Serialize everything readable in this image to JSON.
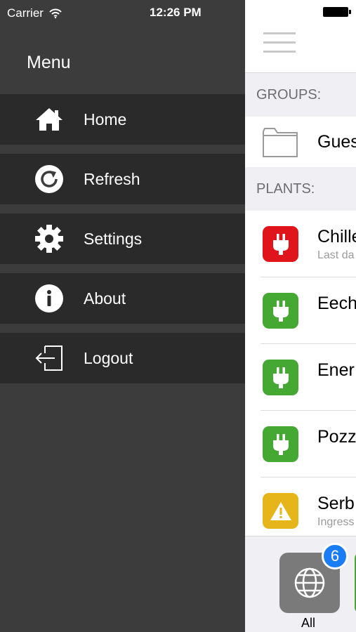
{
  "status_bar": {
    "carrier": "Carrier",
    "time": "12:26 PM"
  },
  "drawer": {
    "title": "Menu",
    "items": [
      {
        "label": "Home",
        "icon": "home-icon"
      },
      {
        "label": "Refresh",
        "icon": "refresh-icon"
      },
      {
        "label": "Settings",
        "icon": "gear-icon"
      },
      {
        "label": "About",
        "icon": "info-icon"
      },
      {
        "label": "Logout",
        "icon": "logout-icon"
      }
    ]
  },
  "main": {
    "groups_header": "GROUPS:",
    "groups": [
      {
        "name": "Gues",
        "icon": "folder-icon"
      }
    ],
    "plants_header": "PLANTS:",
    "plants": [
      {
        "name": "Chille",
        "subtitle": "Last da",
        "status": "red",
        "icon": "plug-icon"
      },
      {
        "name": "Eech",
        "subtitle": "",
        "status": "green",
        "icon": "plug-icon"
      },
      {
        "name": "Ener",
        "subtitle": "",
        "status": "green",
        "icon": "plug-icon"
      },
      {
        "name": "Pozz",
        "subtitle": "",
        "status": "green",
        "icon": "plug-icon"
      },
      {
        "name": "Serb",
        "subtitle": "Ingress",
        "status": "yellow",
        "icon": "warning-icon"
      }
    ]
  },
  "tabbar": {
    "all_label": "All",
    "badge_count": "6",
    "icon": "globe-icon"
  },
  "colors": {
    "drawer_bg": "#3c3c3c",
    "menu_item_bg": "#2a2a2a",
    "status_red": "#e0141b",
    "status_green": "#45a832",
    "status_yellow": "#e5b51a",
    "badge_blue": "#1a7cf7"
  }
}
